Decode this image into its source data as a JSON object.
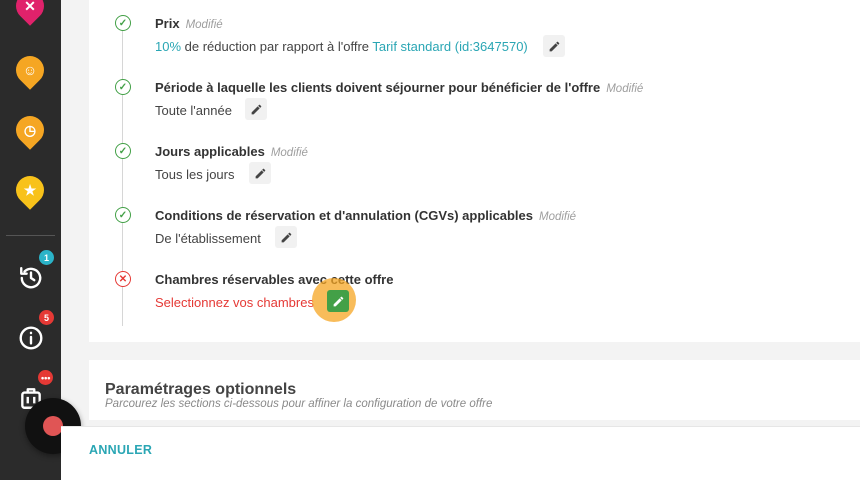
{
  "sidebar": {
    "pins": [
      {
        "name": "offers-pin",
        "icon": "tools-icon",
        "glyph": "✕",
        "color": "#e0226b"
      },
      {
        "name": "bed-pin",
        "icon": "bed-icon",
        "glyph": "☺",
        "color": "#f5a623"
      },
      {
        "name": "clock-pin",
        "icon": "clock-icon",
        "glyph": "◷",
        "color": "#f5a623"
      },
      {
        "name": "star-pin",
        "icon": "star-icon",
        "glyph": "★",
        "color": "#f8c21a"
      }
    ],
    "history_badge": "1",
    "info_badge": "5",
    "bag_badge": "•••"
  },
  "steps": {
    "prix": {
      "title": "Prix",
      "modified": "Modifié",
      "value_prefix": "10%",
      "value_middle": " de réduction par rapport à l'offre ",
      "value_link": "Tarif standard (id:3647570)"
    },
    "periode": {
      "title": "Période à laquelle les clients doivent séjourner pour bénéficier de l'offre",
      "modified": "Modifié",
      "value": "Toute l'année"
    },
    "jours": {
      "title": "Jours applicables",
      "modified": "Modifié",
      "value": "Tous les jours"
    },
    "conditions": {
      "title": "Conditions de réservation et d'annulation (CGVs) applicables",
      "modified": "Modifié",
      "value": "De l'établissement"
    },
    "chambres": {
      "title": "Chambres réservables avec cette offre",
      "value": "Selectionnez vos chambres"
    }
  },
  "optional": {
    "title": "Paramétrages optionnels",
    "subtitle": "Parcourez les sections ci-dessous pour affiner la configuration de votre offre"
  },
  "footer": {
    "cancel_label": "ANNULER"
  },
  "colors": {
    "accent": "#2aa6b4",
    "success": "#43a047",
    "error": "#e53935",
    "highlight": "#f5a623"
  }
}
